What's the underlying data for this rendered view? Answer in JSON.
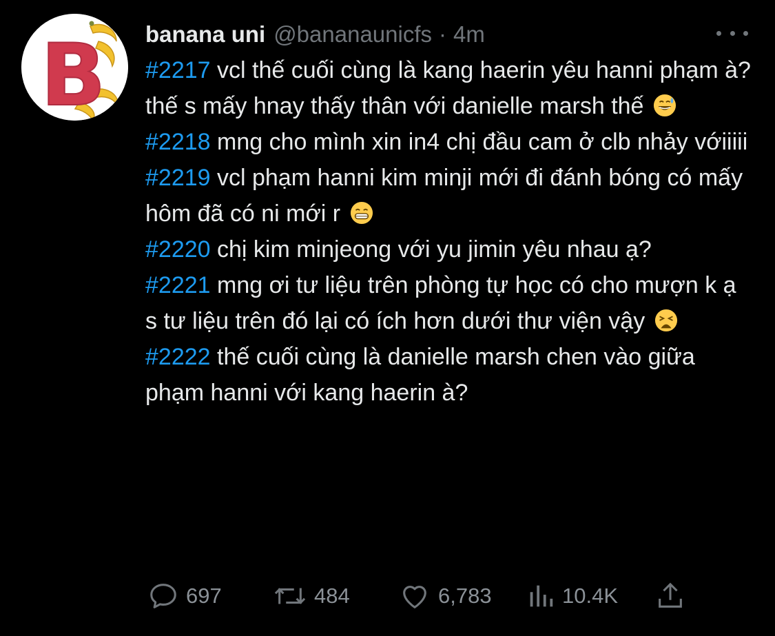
{
  "tweet": {
    "display_name": "banana uni",
    "handle": "@bananaunicfs",
    "separator": "·",
    "time": "4m",
    "avatar_letter": "B",
    "posts": [
      {
        "tag": "#2217",
        "text": " vcl thế cuối cùng là kang haerin yêu hanni phạm à? thế s mấy hnay thấy thân với danielle marsh thế",
        "emoji": "sweat-smile-emoji"
      },
      {
        "tag": "#2218",
        "text": " mng cho mình xin in4 chị đầu cam ở clb nhảy vớiiiii",
        "emoji": ""
      },
      {
        "tag": "#2219",
        "text": " vcl phạm hanni kim minji mới đi đánh bóng có mấy hôm đã có ni mới r",
        "emoji": "grin-emoji"
      },
      {
        "tag": "#2220",
        "text": " chị kim minjeong với yu jimin yêu nhau ạ?",
        "emoji": ""
      },
      {
        "tag": "#2221",
        "text": " mng ơi tư liệu trên phòng tự học có cho mượn k ạ s tư liệu trên đó lại có ích hơn dưới thư viện vậy",
        "emoji": "weary-emoji"
      },
      {
        "tag": "#2222",
        "text": " thế cuối cùng là danielle marsh chen vào giữa phạm hanni với kang haerin à?",
        "emoji": ""
      }
    ],
    "actions": {
      "replies": "697",
      "retweets": "484",
      "likes": "6,783",
      "views": "10.4K"
    }
  },
  "colors": {
    "background": "#000000",
    "text": "#e7e9ea",
    "muted": "#71767b",
    "accent": "#1d9bf0",
    "avatar_letter": "#d03a4e",
    "banana": "#f2c12e"
  }
}
